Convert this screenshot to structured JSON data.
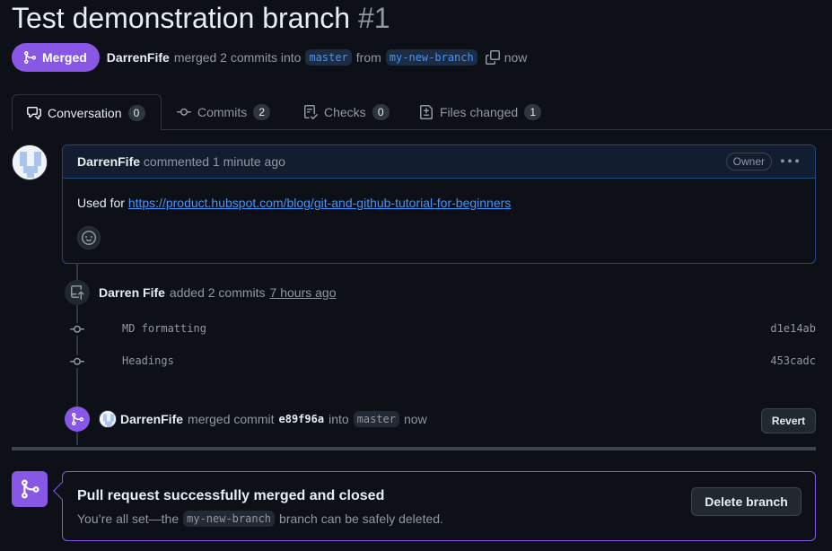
{
  "pr": {
    "title": "Test demonstration branch",
    "number": "#1",
    "state_label": "Merged",
    "author": "DarrenFife",
    "merged_text": "merged 2 commits into",
    "base_branch": "master",
    "from_text": "from",
    "head_branch": "my-new-branch",
    "time": "now"
  },
  "tabs": [
    {
      "label": "Conversation",
      "count": "0",
      "icon": "comment-discussion-icon"
    },
    {
      "label": "Commits",
      "count": "2",
      "icon": "git-commit-icon"
    },
    {
      "label": "Checks",
      "count": "0",
      "icon": "checklist-icon"
    },
    {
      "label": "Files changed",
      "count": "1",
      "icon": "file-diff-icon"
    }
  ],
  "comment": {
    "author": "DarrenFife",
    "action": "commented",
    "time": "1 minute ago",
    "role_badge": "Owner",
    "body_prefix": "Used for",
    "link": "https://product.hubspot.com/blog/git-and-github-tutorial-for-beginners"
  },
  "commits_event": {
    "author": "Darren Fife",
    "action": "added 2 commits",
    "time": "7 hours ago",
    "commits": [
      {
        "message": "MD formatting",
        "sha": "d1e14ab"
      },
      {
        "message": "Headings",
        "sha": "453cadc"
      }
    ]
  },
  "merge_event": {
    "author": "DarrenFife",
    "action": "merged commit",
    "sha": "e89f96a",
    "into": "into",
    "branch": "master",
    "time": "now",
    "revert_label": "Revert"
  },
  "merge_status": {
    "title": "Pull request successfully merged and closed",
    "sub_prefix": "You’re all set—the",
    "branch": "my-new-branch",
    "sub_suffix": "branch can be safely deleted.",
    "delete_label": "Delete branch"
  },
  "colors": {
    "background": "#0d1117",
    "merged_purple": "#8957e5",
    "link_blue": "#4493f8",
    "muted_text": "#9198a1",
    "border": "#30363d"
  }
}
